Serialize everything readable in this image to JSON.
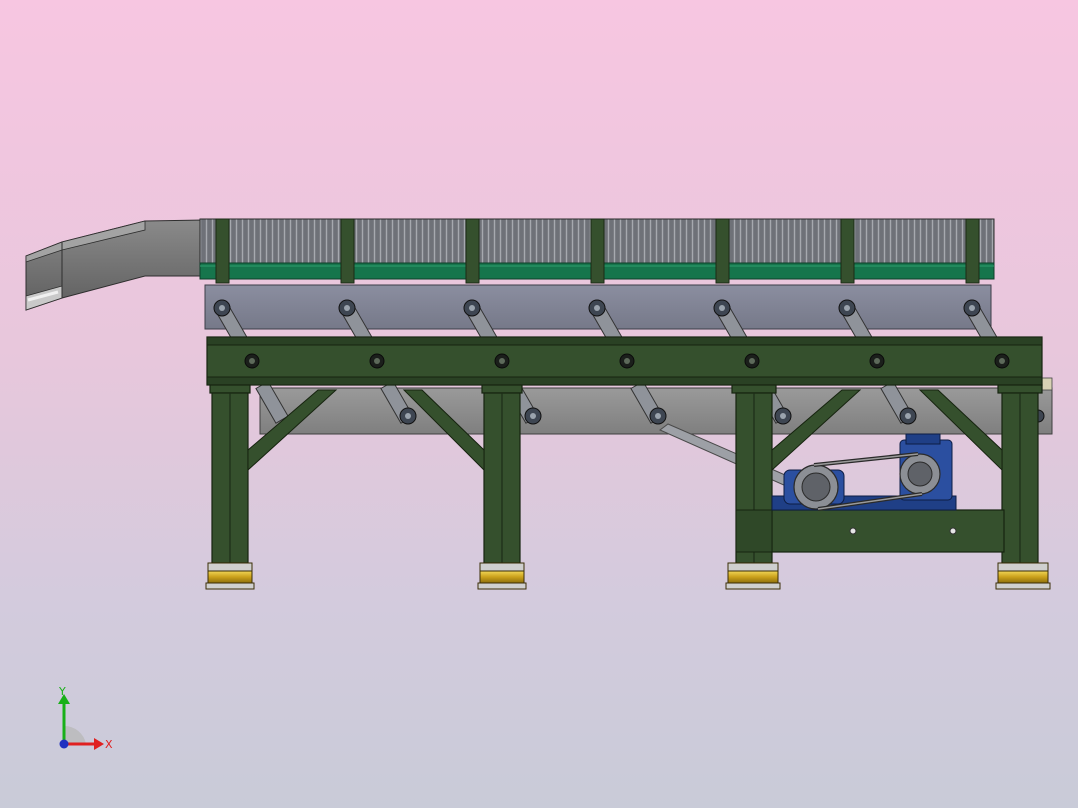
{
  "viewport": {
    "background_top": "#f7c6e1",
    "background_bottom": "#c9cbd8"
  },
  "model": {
    "frame_color": "#35502d",
    "frame_dark": "#1f3219",
    "roller_color": "#7c7f86",
    "guide_rail_color": "#7e8192",
    "conveyor_green": "#16754c",
    "motor_color": "#1f3f86",
    "foot_color": "#d7b52a",
    "legs_count": 4,
    "chain_guides_count": 7
  },
  "triad": {
    "x_label": "X",
    "y_label": "Y",
    "x_color": "#e02020",
    "y_color": "#18b018",
    "z_color": "#2030c0"
  }
}
